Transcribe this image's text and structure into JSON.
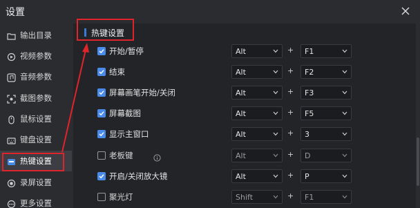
{
  "window": {
    "title": "设置"
  },
  "sidebar": {
    "items": [
      {
        "label": "输出目录",
        "icon": "folder-icon"
      },
      {
        "label": "视频参数",
        "icon": "video-icon"
      },
      {
        "label": "音频参数",
        "icon": "audio-icon"
      },
      {
        "label": "截图参数",
        "icon": "screenshot-icon"
      },
      {
        "label": "鼠标设置",
        "icon": "mouse-icon"
      },
      {
        "label": "键盘设置",
        "icon": "keyboard-icon"
      },
      {
        "label": "热键设置",
        "icon": "hotkey-icon",
        "active": true
      },
      {
        "label": "录屏设置",
        "icon": "record-icon"
      },
      {
        "label": "更多设置",
        "icon": "more-icon"
      }
    ]
  },
  "main": {
    "section_title": "热键设置",
    "rows": [
      {
        "label": "开始/暂停",
        "checked": true,
        "key1": "Alt",
        "plus": "+",
        "key2": "F1"
      },
      {
        "label": "结束",
        "checked": true,
        "key1": "Alt",
        "plus": "+",
        "key2": "F2"
      },
      {
        "label": "屏幕画笔开始/关闭",
        "checked": true,
        "key1": "Alt",
        "plus": "+",
        "key2": "F3"
      },
      {
        "label": "屏幕截图",
        "checked": true,
        "key1": "Alt",
        "plus": "+",
        "key2": "F5"
      },
      {
        "label": "显示主窗口",
        "checked": true,
        "key1": "Alt",
        "plus": "+",
        "key2": "3"
      },
      {
        "label": "老板键",
        "checked": false,
        "key1": "Alt",
        "plus": "+",
        "key2": "D",
        "has_info": true
      },
      {
        "label": "开启/关闭放大镜",
        "checked": true,
        "key1": "Alt",
        "plus": "+",
        "key2": "P"
      },
      {
        "label": "聚光灯",
        "checked": false,
        "key1": "Shift",
        "plus": "+",
        "key2": "F1"
      }
    ]
  },
  "colors": {
    "accent": "#4a8bea",
    "annotation": "#e0242b"
  }
}
